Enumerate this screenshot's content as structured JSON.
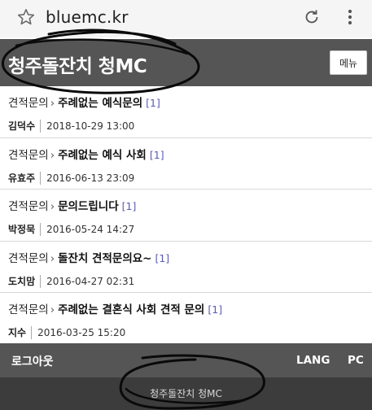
{
  "browser": {
    "url": "bluemc.kr",
    "icons": {
      "bookmark": "star-icon",
      "reload": "reload-icon",
      "overflow": "more-vert-icon"
    }
  },
  "header": {
    "site_title": "청주돌잔치 청MC",
    "menu_label": "메뉴",
    "bg_color": "#555555"
  },
  "posts": [
    {
      "category": "견적문의",
      "separator": "›",
      "title": "주례없는 예식문의",
      "count": "[1]",
      "author": "김덕수",
      "date": "2018-10-29 13:00"
    },
    {
      "category": "견적문의",
      "separator": "›",
      "title": "주례없는 예식 사회",
      "count": "[1]",
      "author": "유효주",
      "date": "2016-06-13 23:09"
    },
    {
      "category": "견적문의",
      "separator": "›",
      "title": "문의드립니다",
      "count": "[1]",
      "author": "박정묵",
      "date": "2016-05-24 14:27"
    },
    {
      "category": "견적문의",
      "separator": "›",
      "title": "돌잔치 견적문의요~",
      "count": "[1]",
      "author": "도치맘",
      "date": "2016-04-27 02:31"
    },
    {
      "category": "견적문의",
      "separator": "›",
      "title": "주례없는 결혼식 사회 견적 문의",
      "count": "[1]",
      "author": "지수",
      "date": "2016-03-25 15:20"
    }
  ],
  "footer": {
    "logout": "로그아웃",
    "lang": "LANG",
    "pc": "PC",
    "copyright": "청주돌잔치 청MC"
  },
  "colors": {
    "comment_count": "#5a5ab5",
    "footer_bg": "#3c3c3c"
  }
}
